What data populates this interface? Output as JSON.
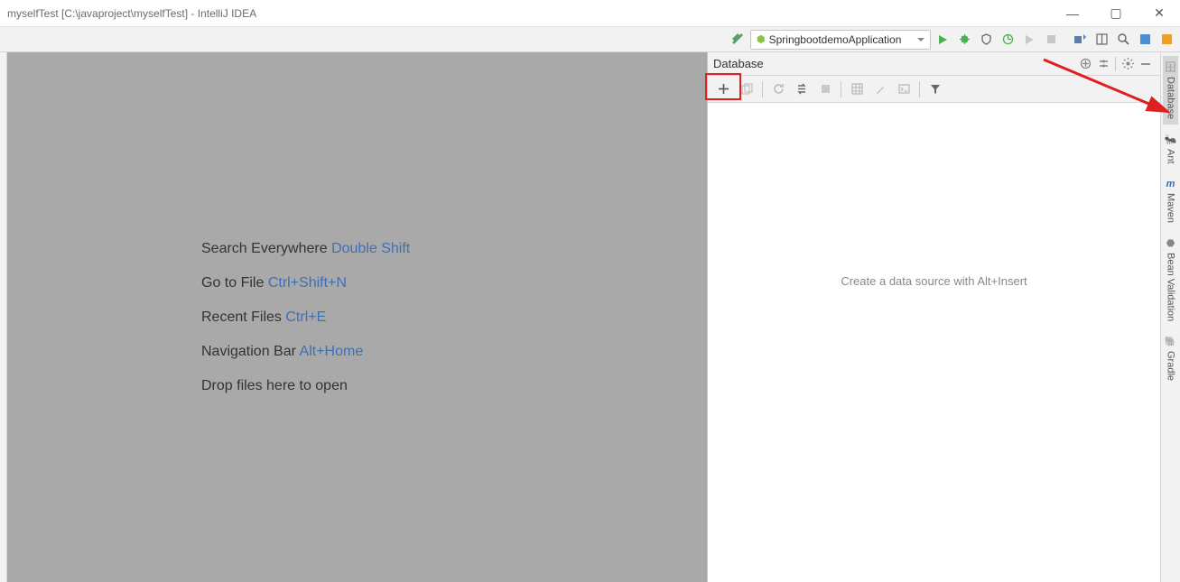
{
  "window": {
    "title": "myselfTest [C:\\javaproject\\myselfTest] - IntelliJ IDEA"
  },
  "toolbar": {
    "run_config": "SpringbootdemoApplication"
  },
  "editor_hints": [
    {
      "label": "Search Everywhere",
      "hotkey": "Double Shift"
    },
    {
      "label": "Go to File",
      "hotkey": "Ctrl+Shift+N"
    },
    {
      "label": "Recent Files",
      "hotkey": "Ctrl+E"
    },
    {
      "label": "Navigation Bar",
      "hotkey": "Alt+Home"
    },
    {
      "label": "Drop files here to open",
      "hotkey": ""
    }
  ],
  "database_panel": {
    "title": "Database",
    "placeholder": "Create a data source with Alt+Insert"
  },
  "right_tabs": [
    {
      "label": "Database",
      "active": true
    },
    {
      "label": "Ant",
      "active": false
    },
    {
      "label": "Maven",
      "active": false
    },
    {
      "label": "Bean Validation",
      "active": false
    },
    {
      "label": "Gradle",
      "active": false
    }
  ]
}
